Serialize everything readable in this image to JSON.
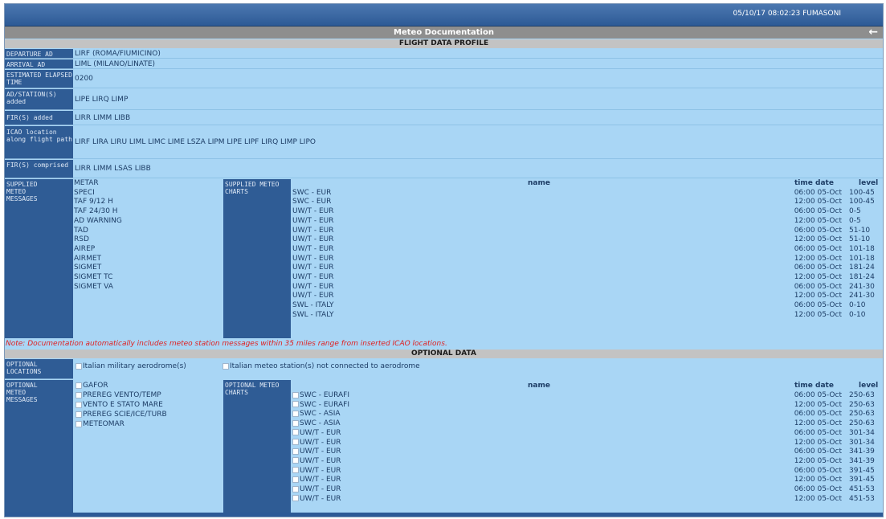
{
  "header": {
    "timestamp": "05/10/17 08:02:23",
    "user": "FUMASONI",
    "title": "Meteo Documentation",
    "back_icon": "arrow-left-icon"
  },
  "flight_data_profile": {
    "heading": "FLIGHT DATA PROFILE",
    "rows": [
      {
        "label": "DEPARTURE AD",
        "value": "LIRF (ROMA/FIUMICINO)"
      },
      {
        "label": "ARRIVAL AD",
        "value": "LIML (MILANO/LINATE)"
      },
      {
        "label": "ESTIMATED ELAPSED TIME",
        "value": "0200"
      },
      {
        "label": "AD/STATION(S) added",
        "value": "LIPE LIRQ LIMP"
      },
      {
        "label": "FIR(S) added",
        "value": "LIRR LIMM LIBB"
      },
      {
        "label": "ICAO location along flight path",
        "value": "LIRF LIRA LIRU LIML LIMC LIME LSZA LIPM LIPE LIPF LIRQ LIMP LIPO"
      },
      {
        "label": "FIR(S) comprised",
        "value": "LIRR LIMM LSAS LIBB"
      }
    ]
  },
  "supplied": {
    "messages_label": "SUPPLIED METEO MESSAGES",
    "messages": [
      "METAR",
      "SPECI",
      "TAF 9/12 H",
      "TAF 24/30 H",
      "AD WARNING",
      "TAD",
      "RSD",
      "AIREP",
      "AIRMET",
      "SIGMET",
      "SIGMET TC",
      "SIGMET VA"
    ],
    "charts_label": "SUPPLIED METEO CHARTS",
    "col_name": "name",
    "col_time_date": "time date",
    "col_level": "level",
    "charts": [
      {
        "name": "SWC - EUR",
        "time_date": "06:00 05-Oct",
        "level": "100-45"
      },
      {
        "name": "SWC - EUR",
        "time_date": "12:00 05-Oct",
        "level": "100-45"
      },
      {
        "name": "UW/T - EUR",
        "time_date": "06:00 05-Oct",
        "level": "0-5"
      },
      {
        "name": "UW/T - EUR",
        "time_date": "12:00 05-Oct",
        "level": "0-5"
      },
      {
        "name": "UW/T - EUR",
        "time_date": "06:00 05-Oct",
        "level": "51-10"
      },
      {
        "name": "UW/T - EUR",
        "time_date": "12:00 05-Oct",
        "level": "51-10"
      },
      {
        "name": "UW/T - EUR",
        "time_date": "06:00 05-Oct",
        "level": "101-18"
      },
      {
        "name": "UW/T - EUR",
        "time_date": "12:00 05-Oct",
        "level": "101-18"
      },
      {
        "name": "UW/T - EUR",
        "time_date": "06:00 05-Oct",
        "level": "181-24"
      },
      {
        "name": "UW/T - EUR",
        "time_date": "12:00 05-Oct",
        "level": "181-24"
      },
      {
        "name": "UW/T - EUR",
        "time_date": "06:00 05-Oct",
        "level": "241-30"
      },
      {
        "name": "UW/T - EUR",
        "time_date": "12:00 05-Oct",
        "level": "241-30"
      },
      {
        "name": "SWL - ITALY",
        "time_date": "06:00 05-Oct",
        "level": "0-10"
      },
      {
        "name": "SWL - ITALY",
        "time_date": "12:00 05-Oct",
        "level": "0-10"
      }
    ]
  },
  "note": "Note: Documentation automatically includes meteo station messages within 35 miles range from inserted ICAO locations.",
  "optional_data": {
    "heading": "OPTIONAL DATA",
    "locations_label": "OPTIONAL LOCATIONS",
    "locations": [
      "Italian military aerodrome(s)",
      "Italian meteo station(s) not connected to aerodrome"
    ],
    "messages_label": "OPTIONAL METEO MESSAGES",
    "messages": [
      "GAFOR",
      "PREREG VENTO/TEMP",
      "VENTO E STATO MARE",
      "PREREG SCIE/ICE/TURB",
      "METEOMAR"
    ],
    "charts_label": "OPTIONAL METEO CHARTS",
    "col_name": "name",
    "col_time_date": "time date",
    "col_level": "level",
    "charts": [
      {
        "name": "SWC - EURAFI",
        "time_date": "06:00 05-Oct",
        "level": "250-63"
      },
      {
        "name": "SWC - EURAFI",
        "time_date": "12:00 05-Oct",
        "level": "250-63"
      },
      {
        "name": "SWC - ASIA",
        "time_date": "06:00 05-Oct",
        "level": "250-63"
      },
      {
        "name": "SWC - ASIA",
        "time_date": "12:00 05-Oct",
        "level": "250-63"
      },
      {
        "name": "UW/T - EUR",
        "time_date": "06:00 05-Oct",
        "level": "301-34"
      },
      {
        "name": "UW/T - EUR",
        "time_date": "12:00 05-Oct",
        "level": "301-34"
      },
      {
        "name": "UW/T - EUR",
        "time_date": "06:00 05-Oct",
        "level": "341-39"
      },
      {
        "name": "UW/T - EUR",
        "time_date": "12:00 05-Oct",
        "level": "341-39"
      },
      {
        "name": "UW/T - EUR",
        "time_date": "06:00 05-Oct",
        "level": "391-45"
      },
      {
        "name": "UW/T - EUR",
        "time_date": "12:00 05-Oct",
        "level": "391-45"
      },
      {
        "name": "UW/T - EUR",
        "time_date": "06:00 05-Oct",
        "level": "451-53"
      },
      {
        "name": "UW/T - EUR",
        "time_date": "12:00 05-Oct",
        "level": "451-53"
      }
    ]
  }
}
